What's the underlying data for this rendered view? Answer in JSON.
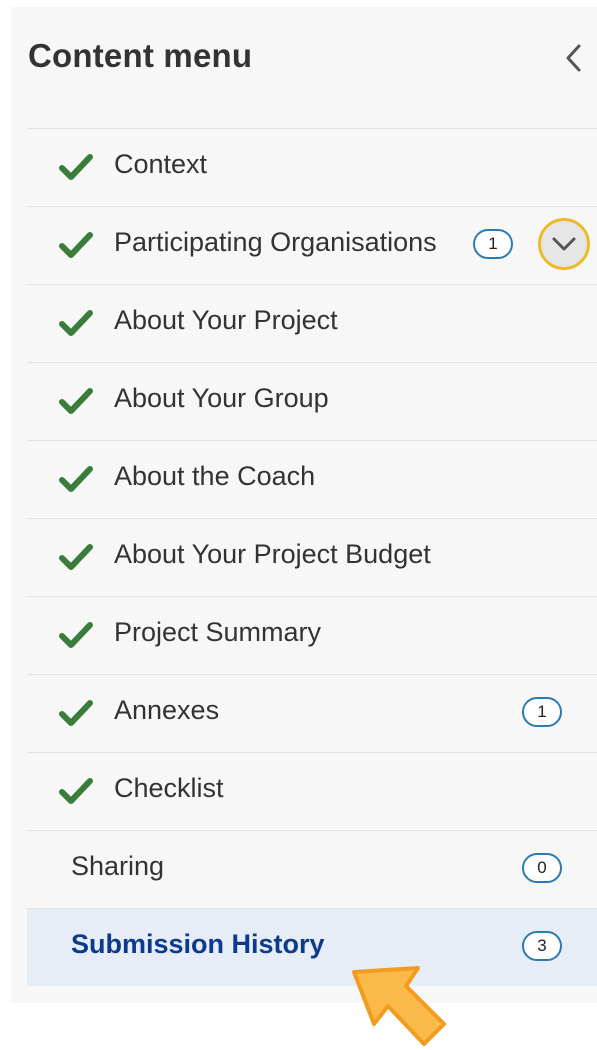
{
  "header": {
    "title": "Content menu"
  },
  "menu": {
    "items": [
      {
        "label": "Context",
        "checked": true,
        "badge": null
      },
      {
        "label": "Participating Organisations",
        "checked": true,
        "badge": "1",
        "expandable": true
      },
      {
        "label": "About Your Project",
        "checked": true,
        "badge": null
      },
      {
        "label": "About Your Group",
        "checked": true,
        "badge": null
      },
      {
        "label": "About the Coach",
        "checked": true,
        "badge": null
      },
      {
        "label": "About Your Project Budget",
        "checked": true,
        "badge": null
      },
      {
        "label": "Project Summary",
        "checked": true,
        "badge": null
      },
      {
        "label": "Annexes",
        "checked": true,
        "badge": "1"
      },
      {
        "label": "Checklist",
        "checked": true,
        "badge": null
      },
      {
        "label": "Sharing",
        "checked": false,
        "badge": "0"
      },
      {
        "label": "Submission History",
        "checked": false,
        "badge": "3",
        "active": true
      }
    ]
  },
  "colors": {
    "check": "#3a7d3a",
    "badge_border": "#2a7ab3",
    "active_bg": "#e6edf6",
    "active_text": "#0e3a8c",
    "focus_ring": "#f0b92c",
    "pointer": "#fbb94a"
  },
  "icons": {
    "check": "check-icon",
    "collapse": "chevron-left-icon",
    "expand": "chevron-down-icon",
    "pointer": "arrow-pointer-icon"
  }
}
